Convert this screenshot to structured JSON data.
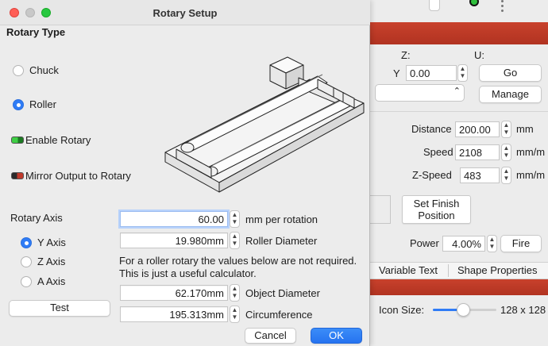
{
  "dialog": {
    "title": "Rotary Setup",
    "rotary_type_label": "Rotary Type",
    "options": [
      {
        "label": "Chuck",
        "selected": false
      },
      {
        "label": "Roller",
        "selected": true
      }
    ],
    "enable_rotary_label": "Enable Rotary",
    "mirror_output_label": "Mirror Output to Rotary",
    "rotary_axis_label": "Rotary Axis",
    "axes": [
      {
        "label": "Y Axis",
        "selected": true
      },
      {
        "label": "Z Axis",
        "selected": false
      },
      {
        "label": "A Axis",
        "selected": false
      }
    ],
    "test_button": "Test",
    "mm_per_rotation": {
      "value": "60.00",
      "label": "mm per rotation"
    },
    "roller_diameter": {
      "value": "19.980mm",
      "label": "Roller Diameter"
    },
    "note_line1": "For a roller rotary the values below are not required.",
    "note_line2": "This is just a useful calculator.",
    "object_diameter": {
      "value": "62.170mm",
      "label": "Object Diameter"
    },
    "circumference": {
      "value": "195.313mm",
      "label": "Circumference"
    },
    "cancel_button": "Cancel",
    "ok_button": "OK"
  },
  "background": {
    "z_label": "Z:",
    "u_label": "U:",
    "y_label": "Y",
    "y_value": "0.00",
    "go_button": "Go",
    "manage_button": "Manage",
    "distance_label": "Distance",
    "distance_value": "200.00",
    "distance_unit": "mm",
    "speed_label": "Speed",
    "speed_value": "2108",
    "speed_unit": "mm/m",
    "zspeed_label": "Z-Speed",
    "zspeed_value": "483",
    "zspeed_unit": "mm/m",
    "set_finish_line1": "Set Finish",
    "set_finish_line2": "Position",
    "power_label": "Power",
    "power_value": "4.00%",
    "fire_button": "Fire",
    "tab_variable_text": "Variable Text",
    "tab_shape_properties": "Shape Properties",
    "icon_size_label": "Icon Size:",
    "icon_size_value": "128 x 128",
    "icon_size_slider": 0.45
  },
  "colors": {
    "accent": "#2f7cf6",
    "red_bar": "#c03a27",
    "close": "#ff5f57",
    "maximize": "#28c840"
  }
}
